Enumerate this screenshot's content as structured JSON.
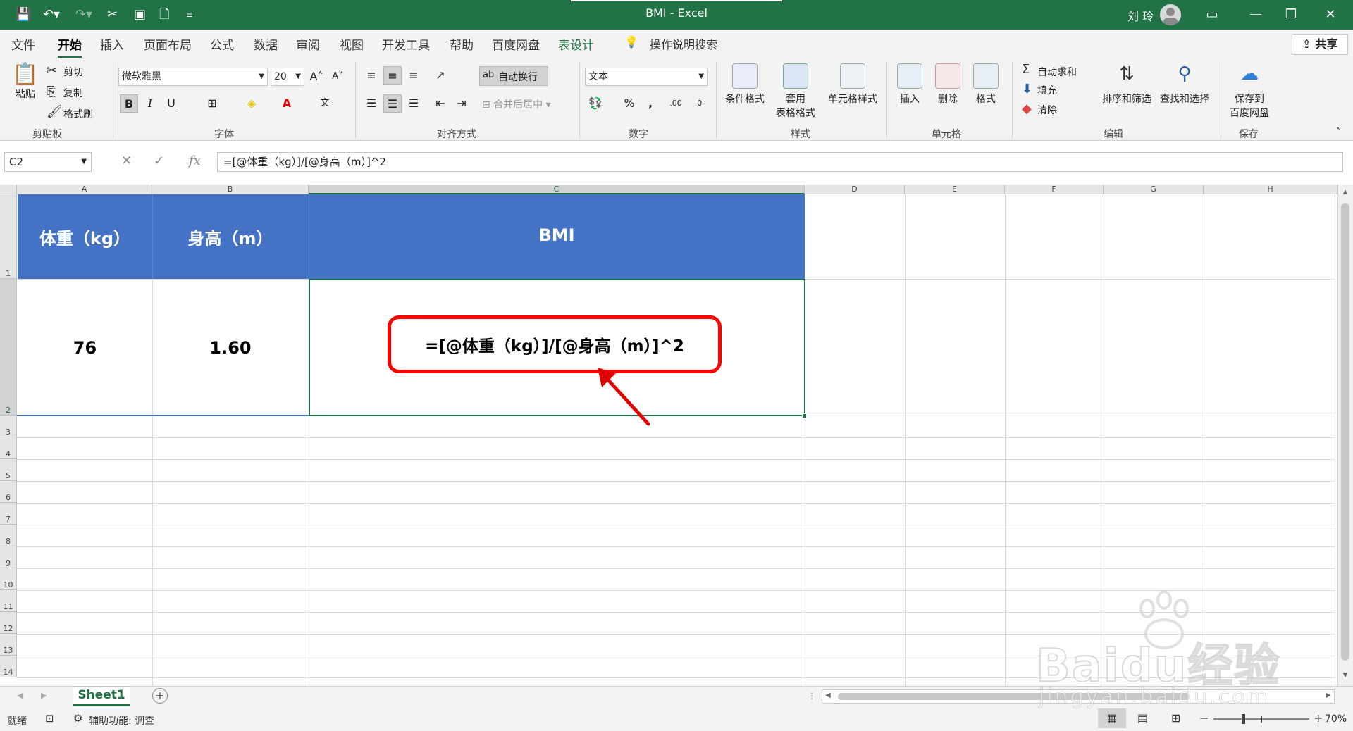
{
  "window": {
    "title": "BMI  -  Excel",
    "user": "刘 玲",
    "theme_color": "#217346"
  },
  "quick_access": {
    "icons": [
      "save-icon",
      "undo-icon",
      "redo-icon",
      "cut-icon",
      "screen-icon",
      "new-file-icon",
      "customize-icon"
    ]
  },
  "tabs": [
    {
      "label": "文件"
    },
    {
      "label": "开始",
      "active": true
    },
    {
      "label": "插入"
    },
    {
      "label": "页面布局"
    },
    {
      "label": "公式"
    },
    {
      "label": "数据"
    },
    {
      "label": "审阅"
    },
    {
      "label": "视图"
    },
    {
      "label": "开发工具"
    },
    {
      "label": "帮助"
    },
    {
      "label": "百度网盘"
    },
    {
      "label": "表设计",
      "highlight": true
    }
  ],
  "search_hint": "操作说明搜索",
  "share_label": "共享",
  "ribbon": {
    "clipboard": {
      "paste": "粘贴",
      "cut": "剪切",
      "copy": "复制",
      "format_painter": "格式刷",
      "group": "剪贴板"
    },
    "font": {
      "name": "微软雅黑",
      "size": "20",
      "group": "字体",
      "bold": "B",
      "italic": "I",
      "underline": "U"
    },
    "alignment": {
      "wrap": "自动换行",
      "merge": "合并后居中",
      "group": "对齐方式"
    },
    "number": {
      "format": "文本",
      "percent": "%",
      "comma": ",",
      "group": "数字"
    },
    "styles": {
      "conditional": "条件格式",
      "table_1": "套用",
      "table_2": "表格格式",
      "cell_style": "单元格样式",
      "group": "样式"
    },
    "cells": {
      "insert": "插入",
      "delete": "删除",
      "format": "格式",
      "group": "单元格"
    },
    "editing": {
      "autosum": "自动求和",
      "fill": "填充",
      "clear": "清除",
      "sort": "排序和筛选",
      "find": "查找和选择",
      "group": "编辑"
    },
    "save": {
      "save_1": "保存到",
      "save_2": "百度网盘",
      "group": "保存"
    }
  },
  "formula_bar": {
    "name_box": "C2",
    "formula": "=[@体重（kg）]/[@身高（m）]^2"
  },
  "columns": [
    {
      "label": "A"
    },
    {
      "label": "B"
    },
    {
      "label": "C",
      "selected": true
    },
    {
      "label": "D"
    },
    {
      "label": "E"
    },
    {
      "label": "F"
    },
    {
      "label": "G"
    },
    {
      "label": "H"
    }
  ],
  "rows": [
    "1",
    "2",
    "3",
    "4",
    "5",
    "6",
    "7",
    "8",
    "9",
    "10",
    "11",
    "12",
    "13",
    "14"
  ],
  "table": {
    "header_color": "#4472c4",
    "headers": [
      "体重（kg）",
      "身高（m）",
      "BMI"
    ],
    "values": [
      "76",
      "1.60",
      ""
    ]
  },
  "callout": {
    "text": "=[@体重（kg）]/[@身高（m）]^2",
    "color": "#ff0000"
  },
  "sheet_tabs": [
    "Sheet1"
  ],
  "status": {
    "ready": "就绪",
    "accessibility": "辅助功能: 调查",
    "zoom": "70%"
  },
  "watermark": {
    "brand": "Baidu经验",
    "url": "jingyan.baidu.com"
  }
}
